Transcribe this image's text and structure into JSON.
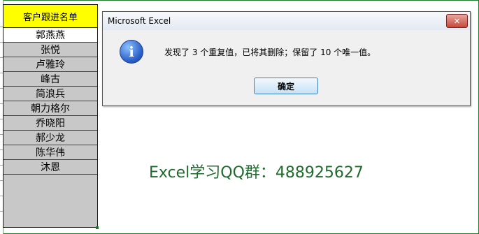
{
  "sheet": {
    "header": "客户跟进名单",
    "names": [
      "郭燕燕",
      "张悦",
      "卢雅玲",
      "峰古",
      "简浪兵",
      "朝力格尔",
      "乔晓阳",
      "郝少龙",
      "陈华伟",
      "沐恩"
    ],
    "selected_index": 0
  },
  "dialog": {
    "title": "Microsoft Excel",
    "close_label": "✕",
    "icon": "info-icon",
    "message": "发现了 3 个重复值，已将其删除；保留了 10 个唯一值。",
    "ok_label": "确定"
  },
  "promo": "Excel学习QQ群：488925627",
  "colors": {
    "header_bg": "#ffff00",
    "list_bg": "#c8c8c8",
    "frame": "#1f7a2e",
    "promo": "#1f6b2e"
  }
}
